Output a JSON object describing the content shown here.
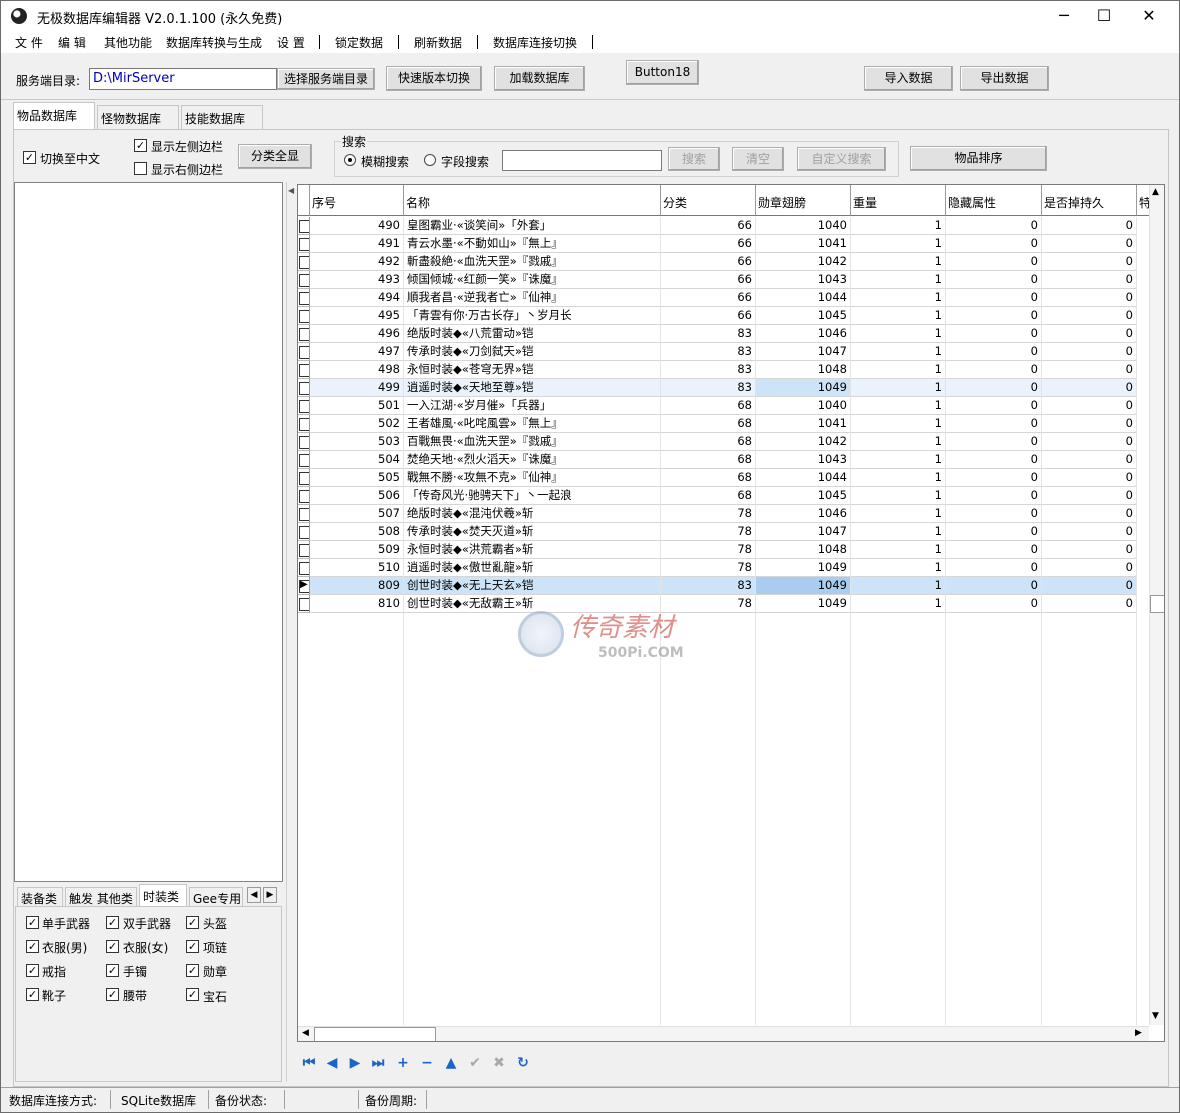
{
  "window": {
    "title": "无极数据库编辑器 V2.0.1.100 (永久免费)",
    "min": "─",
    "max": "☐",
    "close": "✕"
  },
  "menu": [
    "文 件",
    "编 辑",
    "其他功能",
    "数据库转换与生成",
    "设 置",
    "锁定数据",
    "刷新数据",
    "数据库连接切换"
  ],
  "toolbar": {
    "server_dir_label": "服务端目录:",
    "server_dir_value": "D:\\MirServer",
    "select_dir": "选择服务端目录",
    "quick_switch": "快速版本切换",
    "load_db": "加载数据库",
    "button18": "Button18",
    "import": "导入数据",
    "export": "导出数据"
  },
  "tabs": [
    "物品数据库",
    "怪物数据库",
    "技能数据库"
  ],
  "options": {
    "to_chinese": "切换至中文",
    "show_left": "显示左侧边栏",
    "show_right": "显示右侧边栏",
    "show_all_categories": "分类全显"
  },
  "search": {
    "group": "搜索",
    "fuzzy": "模糊搜索",
    "field": "字段搜索",
    "search_btn": "搜索",
    "clear_btn": "清空",
    "custom_btn": "自定义搜索",
    "input_value": ""
  },
  "sort_btn": "物品排序",
  "category_tabs": [
    "装备类",
    "触发 其他类",
    "时装类",
    "Gee专用"
  ],
  "category_checks": [
    [
      "单手武器",
      "双手武器",
      "头盔"
    ],
    [
      "衣服(男)",
      "衣服(女)",
      "项链"
    ],
    [
      "戒指",
      "手镯",
      "勋章"
    ],
    [
      "靴子",
      "腰带",
      "宝石"
    ]
  ],
  "table": {
    "headers": [
      "序号",
      "名称",
      "分类",
      "勋章翅膀",
      "重量",
      "隐藏属性",
      "是否掉持久",
      "特"
    ],
    "rows": [
      [
        "490",
        "皇图霸业·«谈笑间»「外套」",
        "66",
        "1040",
        "1",
        "0",
        "0"
      ],
      [
        "491",
        "青云水墨·«不動如山»『無上』",
        "66",
        "1041",
        "1",
        "0",
        "0"
      ],
      [
        "492",
        "斬盡殺絶·«血洗天罡»『戮戚』",
        "66",
        "1042",
        "1",
        "0",
        "0"
      ],
      [
        "493",
        "倾国倾城·«红颜一笑»『诛魔』",
        "66",
        "1043",
        "1",
        "0",
        "0"
      ],
      [
        "494",
        "順我者昌·«逆我者亡»『仙神』",
        "66",
        "1044",
        "1",
        "0",
        "0"
      ],
      [
        "495",
        "「青雲有你·万古长存」丶岁月长",
        "66",
        "1045",
        "1",
        "0",
        "0"
      ],
      [
        "496",
        "绝版时装◆«八荒雷动»铠",
        "83",
        "1046",
        "1",
        "0",
        "0"
      ],
      [
        "497",
        "传承时装◆«刀剑弑天»铠",
        "83",
        "1047",
        "1",
        "0",
        "0"
      ],
      [
        "498",
        "永恒时装◆«苍穹无界»铠",
        "83",
        "1048",
        "1",
        "0",
        "0"
      ],
      [
        "499",
        "逍遥时装◆«天地至尊»铠",
        "83",
        "1049",
        "1",
        "0",
        "0"
      ],
      [
        "501",
        "一入江湖·«岁月催»「兵器」",
        "68",
        "1040",
        "1",
        "0",
        "0"
      ],
      [
        "502",
        "王者雄風·«叱咤風雲»『無上』",
        "68",
        "1041",
        "1",
        "0",
        "0"
      ],
      [
        "503",
        "百戰無畏·«血洗天罡»『戮戚』",
        "68",
        "1042",
        "1",
        "0",
        "0"
      ],
      [
        "504",
        "焚绝天地·«烈火滔天»『诛魔』",
        "68",
        "1043",
        "1",
        "0",
        "0"
      ],
      [
        "505",
        "戰無不勝·«攻無不克»『仙神』",
        "68",
        "1044",
        "1",
        "0",
        "0"
      ],
      [
        "506",
        "「传奇风光·驰骋天下」丶一起浪",
        "68",
        "1045",
        "1",
        "0",
        "0"
      ],
      [
        "507",
        "绝版时装◆«混沌伏羲»斩",
        "78",
        "1046",
        "1",
        "0",
        "0"
      ],
      [
        "508",
        "传承时装◆«焚天灭道»斩",
        "78",
        "1047",
        "1",
        "0",
        "0"
      ],
      [
        "509",
        "永恒时装◆«洪荒霸者»斩",
        "78",
        "1048",
        "1",
        "0",
        "0"
      ],
      [
        "510",
        "逍遥时装◆«傲世亂龍»斩",
        "78",
        "1049",
        "1",
        "0",
        "0"
      ],
      [
        "809",
        "创世时装◆«无上天玄»铠",
        "83",
        "1049",
        "1",
        "0",
        "0"
      ],
      [
        "810",
        "创世时装◆«无敌霸王»斩",
        "78",
        "1049",
        "1",
        "0",
        "0"
      ]
    ]
  },
  "watermark": {
    "text": "传奇素材",
    "sub": "500Pi.COM"
  },
  "nav_icons": [
    "first-icon",
    "prior-icon",
    "next-icon",
    "last-icon",
    "insert-icon",
    "delete-icon",
    "edit-icon",
    "post-icon",
    "cancel-icon",
    "refresh-icon"
  ],
  "status": {
    "conn_label": "数据库连接方式:",
    "conn_value": "SQLite数据库",
    "backup_label": "备份状态:",
    "cycle_label": "备份周期:"
  }
}
